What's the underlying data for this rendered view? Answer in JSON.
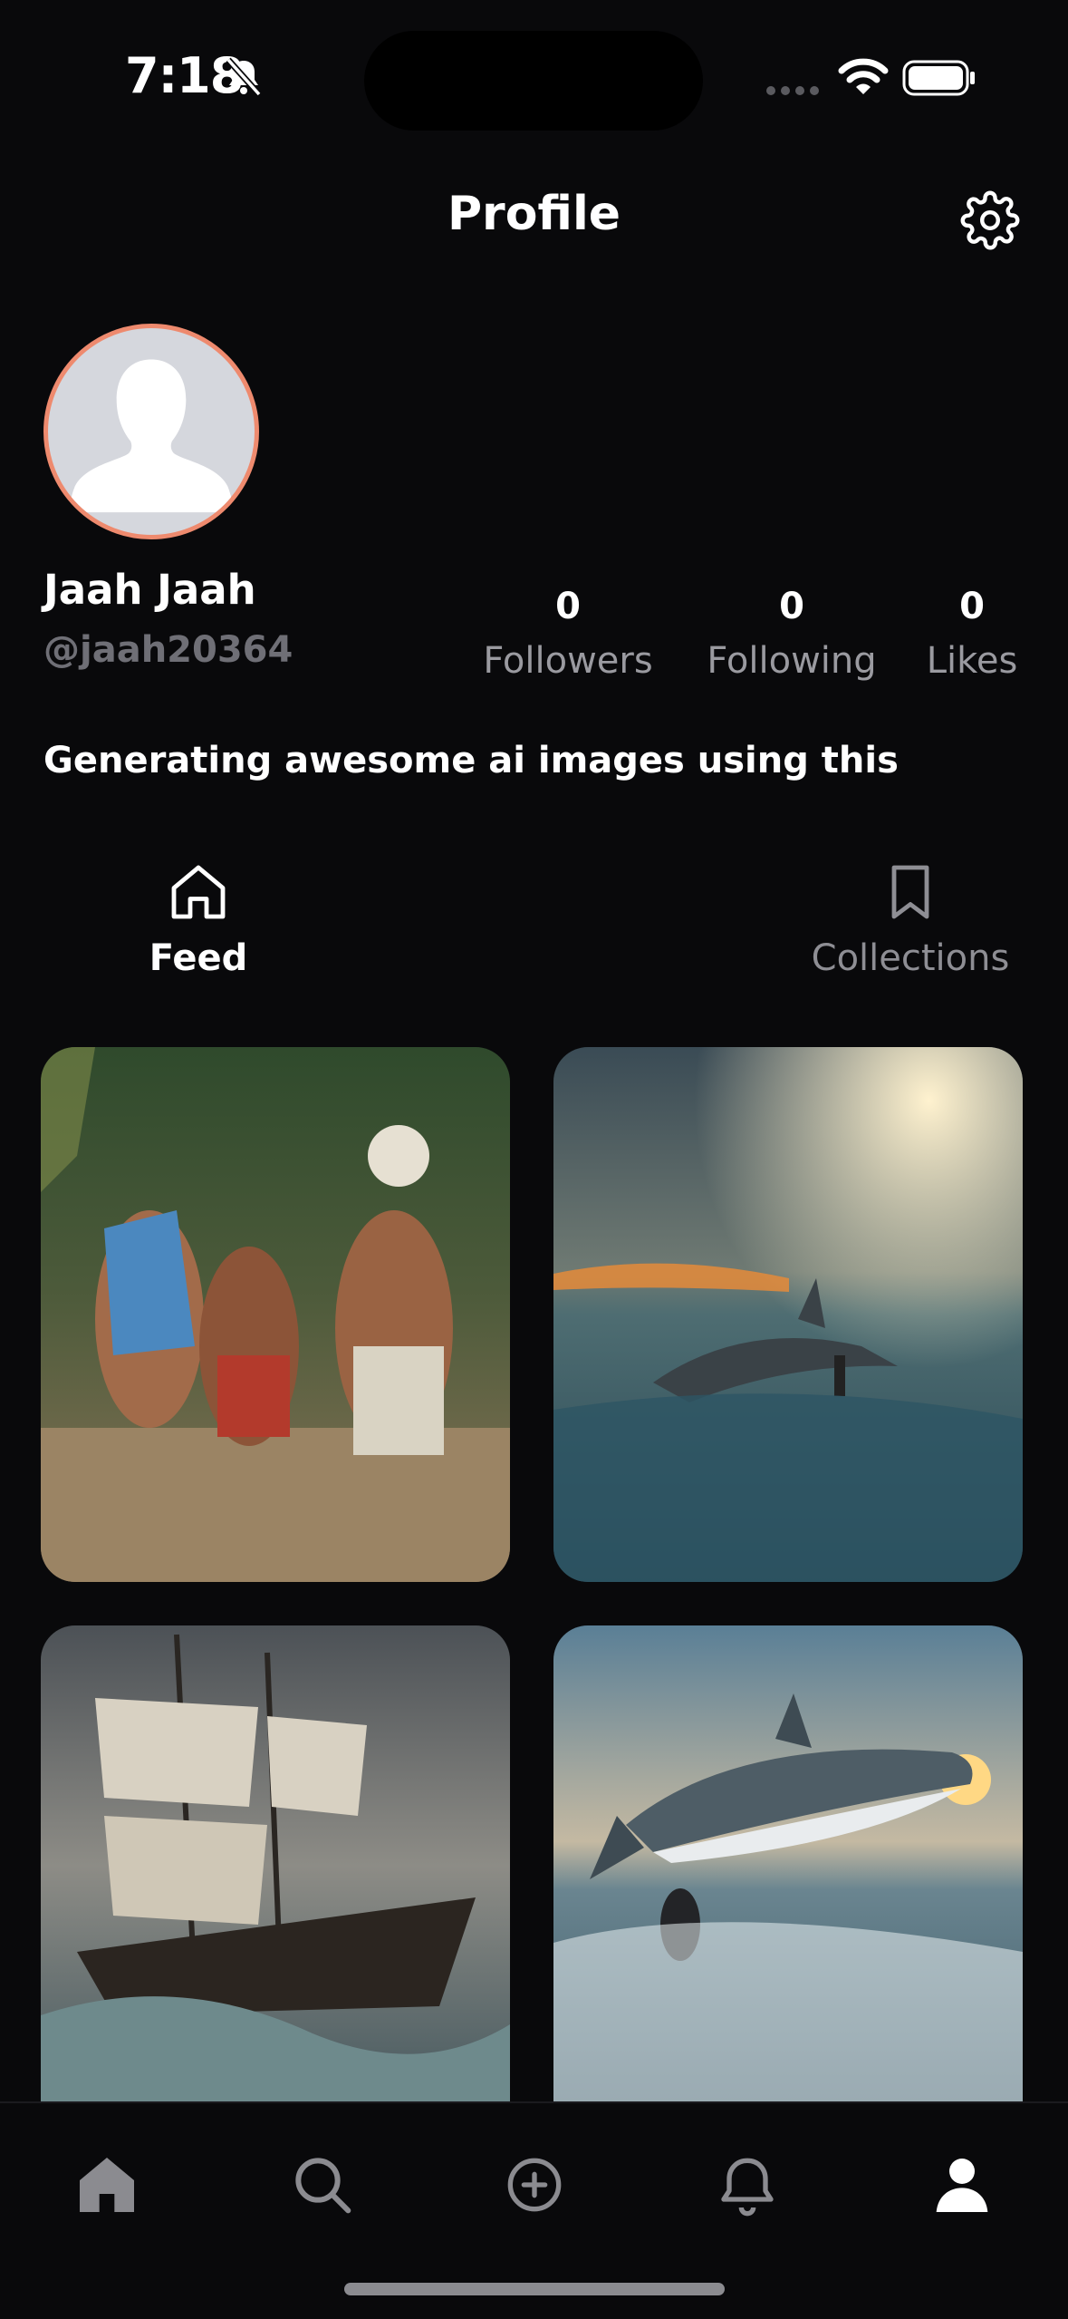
{
  "status_bar": {
    "time": "7:18"
  },
  "header": {
    "title": "Profile"
  },
  "profile": {
    "name": "Jaah Jaah",
    "handle": "@jaah20364",
    "bio": "Generating awesome ai images using this",
    "stats": [
      {
        "value": "0",
        "label": "Followers"
      },
      {
        "value": "0",
        "label": "Following"
      },
      {
        "value": "0",
        "label": "Likes"
      }
    ]
  },
  "tabs": [
    {
      "label": "Feed",
      "icon": "home-outline-icon",
      "active": true
    },
    {
      "label": "Collections",
      "icon": "bookmark-icon",
      "active": false
    }
  ],
  "feed_images": [
    "warriors-fighting",
    "shark-surfer-sunset",
    "sailing-ship-storm",
    "shark-leaping-diver"
  ],
  "bottom_nav": [
    "home",
    "search",
    "create",
    "notifications",
    "profile"
  ],
  "colors": {
    "background": "#09090b",
    "avatar_ring": "#ee8a6e",
    "muted_text": "#9a9aa0"
  }
}
